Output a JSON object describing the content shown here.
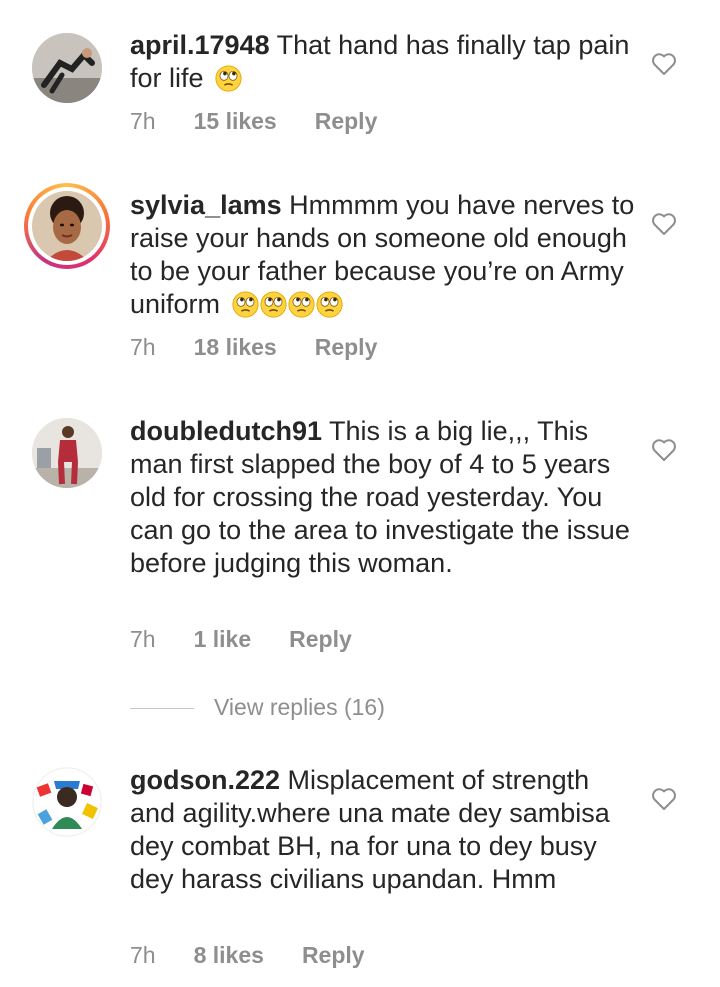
{
  "comments": [
    {
      "username": "april.17948",
      "text": "That hand has finally tap pain for life",
      "emojis": 1,
      "time": "7h",
      "likes": "15 likes",
      "reply": "Reply"
    },
    {
      "username": "sylvia_lams",
      "text": "Hmmmm you have nerves to raise your hands on someone old enough to be your father because you’re on Army uniform",
      "emojis": 4,
      "time": "7h",
      "likes": "18 likes",
      "reply": "Reply"
    },
    {
      "username": "doubledutch91",
      "text": "This is a big lie,,, This man first slapped the boy of 4 to 5 years old for crossing the road yesterday. You can go to the area to investigate the issue before judging this woman.",
      "emojis": 0,
      "time": "7h",
      "likes": "1 like",
      "reply": "Reply",
      "view_replies": "View replies (16)"
    },
    {
      "username": "godson.222",
      "text": "Misplacement of strength and agility.where una mate dey sambisa dey combat BH, na for una to dey busy dey harass civilians upandan. Hmm",
      "emojis": 0,
      "time": "7h",
      "likes": "8 likes",
      "reply": "Reply"
    }
  ],
  "colors": {
    "text": "#262626",
    "secondary": "#8e8e8e",
    "story_ring": [
      "#fdc04a",
      "#e1306c",
      "#c13584"
    ]
  },
  "icons": [
    "heart-icon",
    "face-with-rolling-eyes-emoji"
  ]
}
